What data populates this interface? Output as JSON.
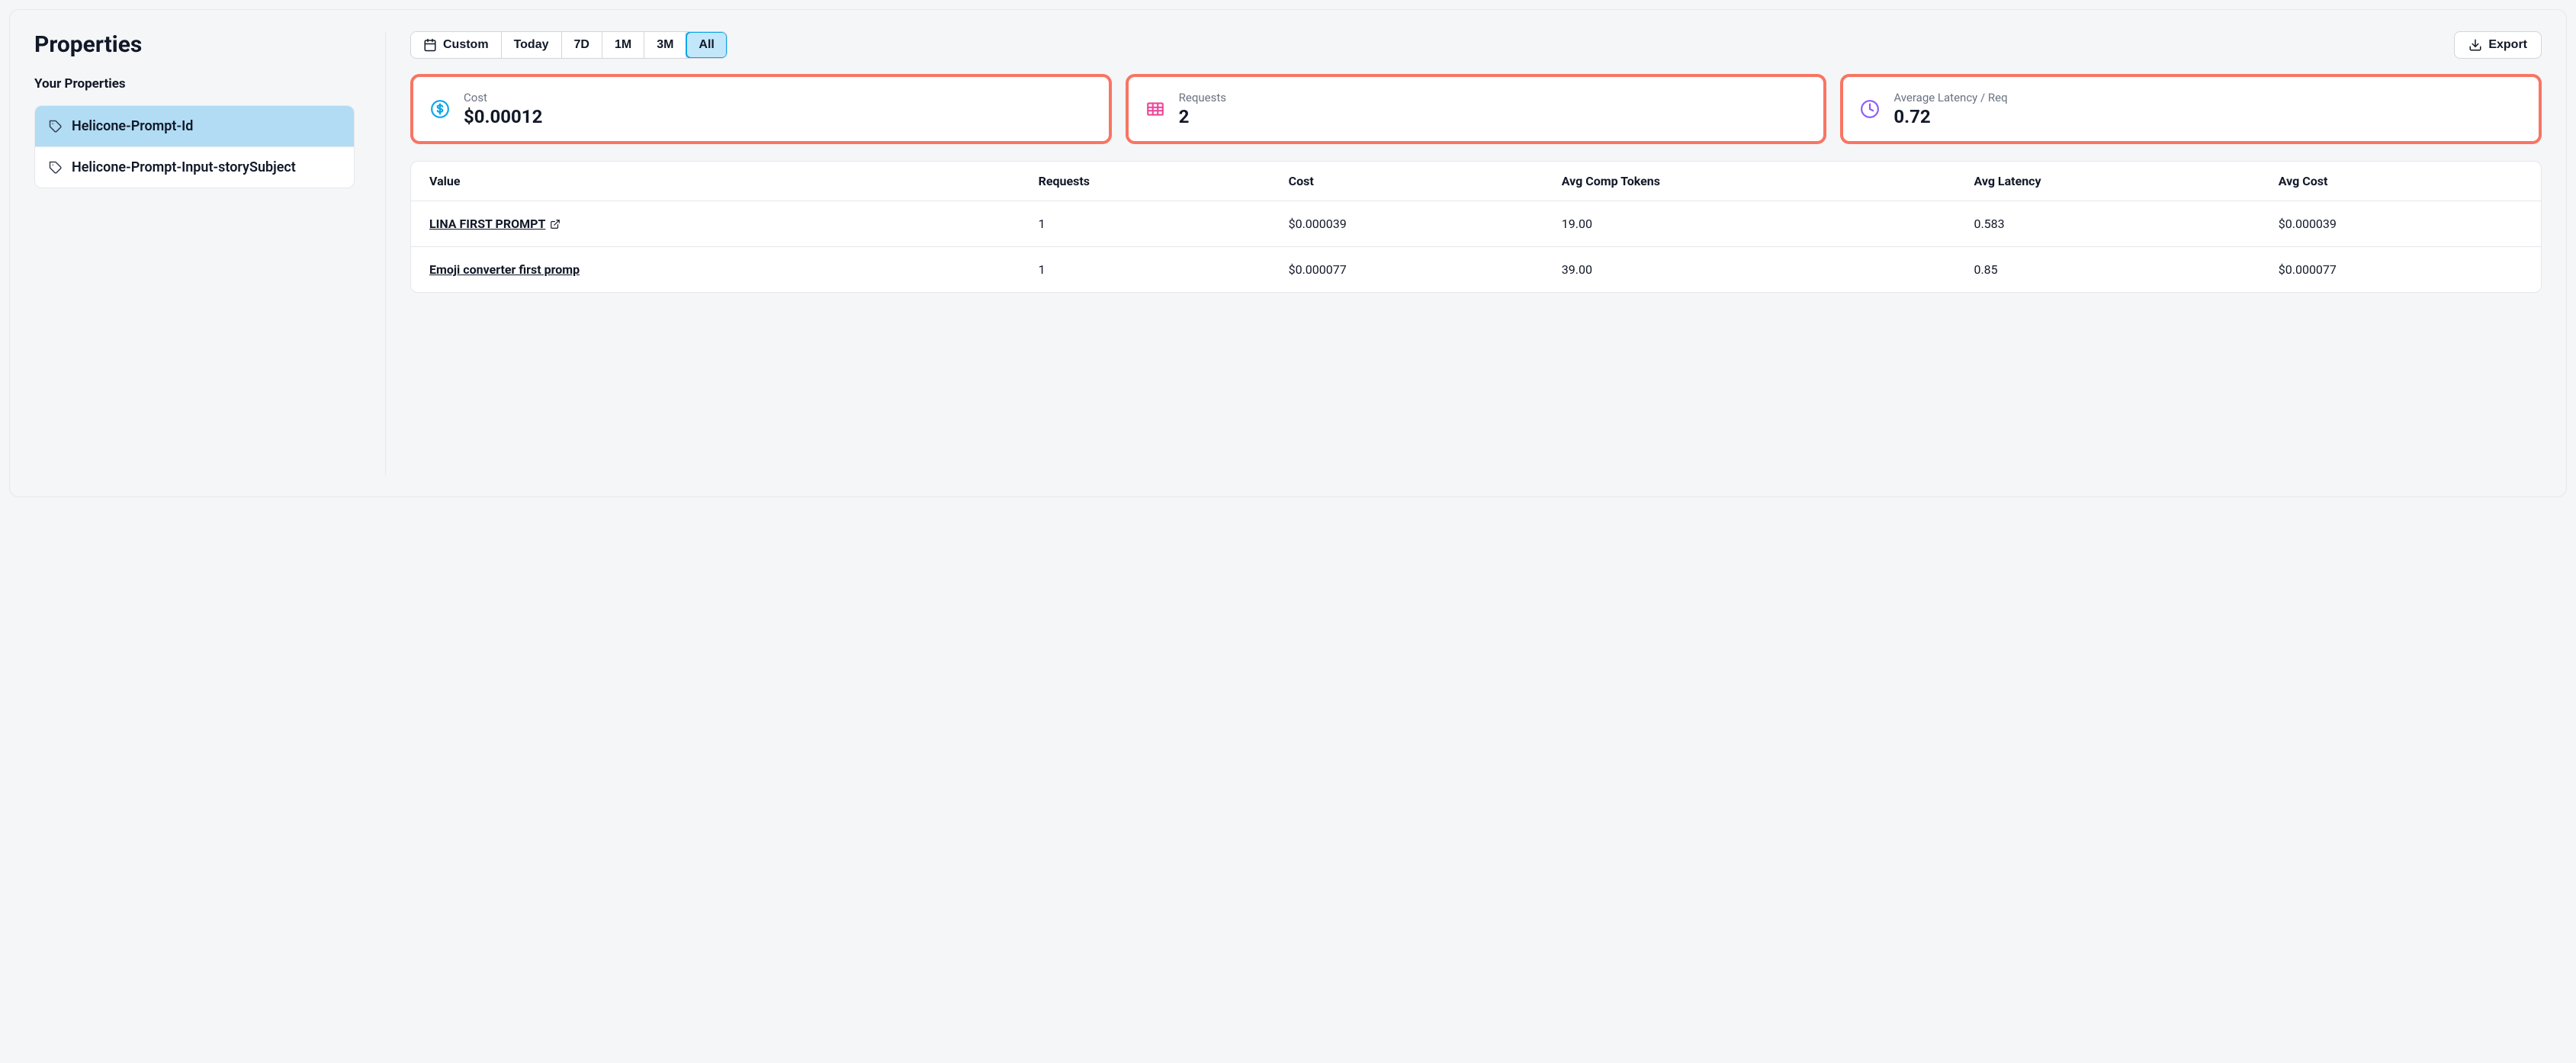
{
  "page": {
    "title": "Properties",
    "section_label": "Your Properties"
  },
  "sidebar": {
    "items": [
      {
        "label": "Helicone-Prompt-Id",
        "active": true
      },
      {
        "label": "Helicone-Prompt-Input-storySubject",
        "active": false
      }
    ]
  },
  "toolbar": {
    "time_filters": [
      {
        "label": "Custom",
        "icon": "calendar",
        "active": false
      },
      {
        "label": "Today",
        "active": false
      },
      {
        "label": "7D",
        "active": false
      },
      {
        "label": "1M",
        "active": false
      },
      {
        "label": "3M",
        "active": false
      },
      {
        "label": "All",
        "active": true
      }
    ],
    "export_label": "Export"
  },
  "stats": [
    {
      "label": "Cost",
      "value": "$0.00012",
      "icon": "dollar",
      "color": "#0ea5e9"
    },
    {
      "label": "Requests",
      "value": "2",
      "icon": "table",
      "color": "#ec4899"
    },
    {
      "label": "Average Latency / Req",
      "value": "0.72",
      "icon": "clock",
      "color": "#8b5cf6"
    }
  ],
  "table": {
    "headers": [
      "Value",
      "Requests",
      "Cost",
      "Avg Comp Tokens",
      "Avg Latency",
      "Avg Cost"
    ],
    "rows": [
      {
        "value": "LINA FIRST PROMPT",
        "has_ext": true,
        "requests": "1",
        "cost": "$0.000039",
        "avg_comp_tokens": "19.00",
        "avg_latency": "0.583",
        "avg_cost": "$0.000039"
      },
      {
        "value": "Emoji converter first promp",
        "has_ext": false,
        "requests": "1",
        "cost": "$0.000077",
        "avg_comp_tokens": "39.00",
        "avg_latency": "0.85",
        "avg_cost": "$0.000077"
      }
    ]
  }
}
